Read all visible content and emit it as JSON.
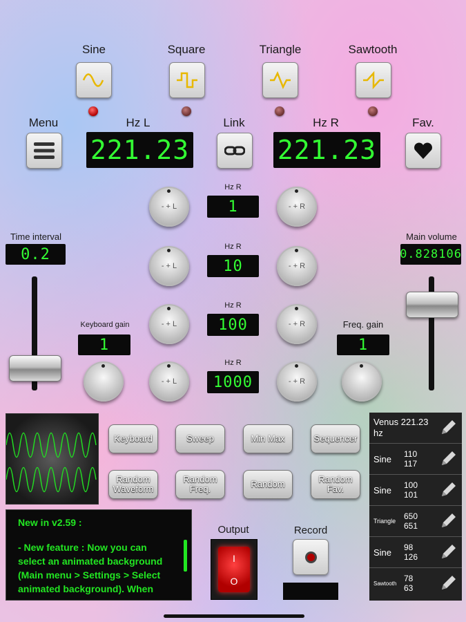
{
  "waveforms": [
    {
      "label": "Sine",
      "led": "on"
    },
    {
      "label": "Square",
      "led": "off"
    },
    {
      "label": "Triangle",
      "led": "off"
    },
    {
      "label": "Sawtooth",
      "led": "off"
    }
  ],
  "top": {
    "menu_label": "Menu",
    "hz_l_label": "Hz L",
    "hz_l_value": "221.23",
    "link_label": "Link",
    "hz_r_label": "Hz R",
    "hz_r_value": "221.23",
    "fav_label": "Fav."
  },
  "steps": [
    {
      "label": "Hz R",
      "value": "1",
      "left_knob": "- + L",
      "right_knob": "- + R"
    },
    {
      "label": "Hz R",
      "value": "10",
      "left_knob": "- + L",
      "right_knob": "- + R"
    },
    {
      "label": "Hz R",
      "value": "100",
      "left_knob": "- + L",
      "right_knob": "- + R"
    },
    {
      "label": "Hz R",
      "value": "1000",
      "left_knob": "- + L",
      "right_knob": "- + R"
    }
  ],
  "time_interval": {
    "label": "Time interval",
    "value": "0.2",
    "level": 0.12
  },
  "main_volume": {
    "label": "Main volume",
    "value": "0.828106",
    "level": 0.83
  },
  "keyboard_gain": {
    "label": "Keyboard gain",
    "value": "1"
  },
  "freq_gain": {
    "label": "Freq. gain",
    "value": "1"
  },
  "buttons": [
    "Keyboard",
    "Sweep",
    "Min Max",
    "Sequencer",
    "Random Waveform",
    "Random Freq.",
    "Random",
    "Random Fav."
  ],
  "news": {
    "title": "New in v2.59 :",
    "body": "- New feature : Now you can select an animated background (Main menu > Settings > Select animated background). When"
  },
  "output_label": "Output",
  "record_label": "Record",
  "favorites": [
    {
      "name": "Venus 221.23 hz",
      "v1": "",
      "v2": ""
    },
    {
      "name": "Sine",
      "v1": "110",
      "v2": "117"
    },
    {
      "name": "Sine",
      "v1": "100",
      "v2": "101"
    },
    {
      "name": "Triangle",
      "v1": "650",
      "v2": "651"
    },
    {
      "name": "Sine",
      "v1": "98",
      "v2": "126"
    },
    {
      "name": "Sawtooth",
      "v1": "78",
      "v2": "63"
    }
  ],
  "colors": {
    "lcd_green": "#33ff33",
    "led_red": "#d00000",
    "news_bg": "#0a0a0a"
  }
}
